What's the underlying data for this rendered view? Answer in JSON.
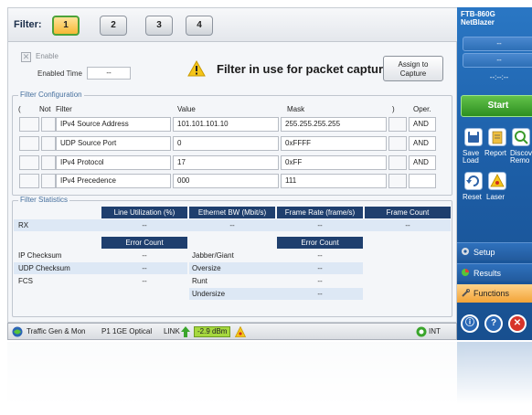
{
  "filter": {
    "label": "Filter:",
    "tabs": [
      "1",
      "2",
      "3",
      "4"
    ],
    "active_tab": "1",
    "enable_label": "Enable",
    "enabled_time_label": "Enabled Time",
    "enabled_time_value": "--",
    "warning": "Filter in use for packet capture",
    "assign_button": "Assign to Capture"
  },
  "config": {
    "title": "Filter Configuration",
    "headers": {
      "paren_open": "(",
      "not": "Not",
      "filter": "Filter",
      "value": "Value",
      "mask": "Mask",
      "paren_close": ")",
      "oper": "Oper."
    },
    "rows": [
      {
        "filter": "IPv4 Source Address",
        "value": "101.101.101.10",
        "mask": "255.255.255.255",
        "oper": "AND"
      },
      {
        "filter": "UDP Source Port",
        "value": "0",
        "mask": "0xFFFF",
        "oper": "AND"
      },
      {
        "filter": "IPv4 Protocol",
        "value": "17",
        "mask": "0xFF",
        "oper": "AND"
      },
      {
        "filter": "IPv4 Precedence",
        "value": "000",
        "mask": "111",
        "oper": ""
      }
    ]
  },
  "stats": {
    "title": "Filter Statistics",
    "top_headers": [
      "Line Utilization (%)",
      "Ethernet BW (Mbit/s)",
      "Frame Rate (frame/s)",
      "Frame Count"
    ],
    "rx_label": "RX",
    "rx_values": [
      "--",
      "--",
      "--",
      "--"
    ],
    "error_count_label": "Error Count",
    "left_errors": [
      {
        "label": "IP Checksum",
        "value": "--"
      },
      {
        "label": "UDP Checksum",
        "value": "--"
      },
      {
        "label": "FCS",
        "value": "--"
      }
    ],
    "right_errors": [
      {
        "label": "Jabber/Giant",
        "value": "--"
      },
      {
        "label": "Oversize",
        "value": "--"
      },
      {
        "label": "Runt",
        "value": "--"
      },
      {
        "label": "Undersize",
        "value": "--"
      }
    ]
  },
  "status_bar": {
    "traffic": "Traffic Gen & Mon",
    "port": "P1 1GE Optical",
    "link": "LINK",
    "dbm": "-2.9 dBm",
    "clock": "INT"
  },
  "right_panel": {
    "title_line1": "FTB-860G",
    "title_line2": "NetBlazer",
    "field1": "--",
    "field2": "--",
    "field3": "--:--:--",
    "start": "Start",
    "save_load": "Save\nLoad",
    "report": "Report",
    "discover": "Discov\nRemo",
    "reset": "Reset",
    "laser": "Laser",
    "setup": "Setup",
    "results": "Results",
    "functions": "Functions"
  },
  "colors": {
    "header_blue": "#1f3f6e",
    "row_blue": "#dde8f5",
    "active_tab": "#f6b835",
    "start_green": "#2d8f1f",
    "link_green": "#a6d83f"
  }
}
